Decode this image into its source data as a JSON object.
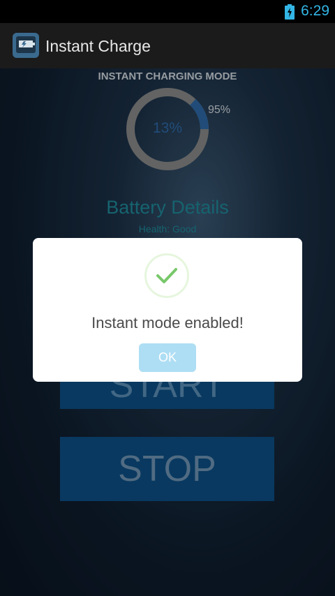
{
  "status_bar": {
    "time": "6:29",
    "battery_icon": "battery-charging-icon"
  },
  "action_bar": {
    "title": "Instant Charge",
    "app_icon": "app-icon"
  },
  "main": {
    "mode_label": "INSTANT CHARGING MODE",
    "gauge": {
      "value_label": "13%",
      "target_label": "95%",
      "progress_fraction": 0.13
    },
    "details": {
      "title": "Battery Details",
      "health": "Health: Good"
    },
    "start_button": "START",
    "stop_button": "STOP"
  },
  "dialog": {
    "icon": "check-icon",
    "message": "Instant mode enabled!",
    "ok_button": "OK"
  },
  "colors": {
    "accent": "#33b5e5",
    "gauge_progress": "#2e6aa8",
    "gauge_track": "#8a8a8a",
    "button_bg": "#0d4f86",
    "details_text": "#1f8a9a",
    "ok_button": "#aedef4",
    "check": "#78c86a"
  }
}
